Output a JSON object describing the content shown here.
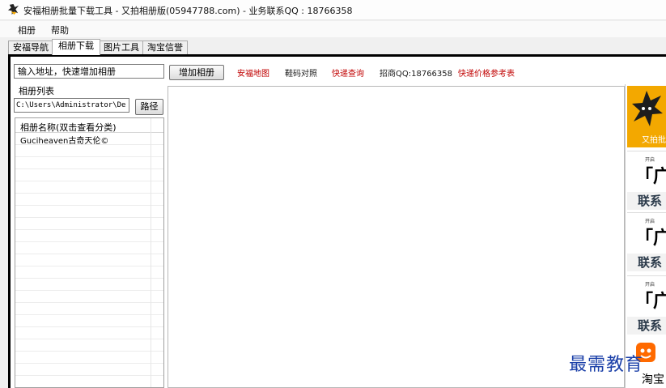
{
  "window": {
    "title": "安福相册批量下载工具 - 又拍相册版(05947788.com) - 业务联系QQ : 18766358"
  },
  "menu": [
    "相册",
    "帮助"
  ],
  "tabs": [
    "安福导航",
    "相册下载",
    "图片工具",
    "淘宝信誉"
  ],
  "active_tab_index": 1,
  "toolbar": {
    "url_placeholder": "输入地址，快速增加相册",
    "add_button": "增加相册",
    "links": [
      "安福地图",
      "鞋码对照",
      "快递查询",
      "招商QQ:18766358",
      "快递价格参考表"
    ]
  },
  "album_section": {
    "label": "相册列表",
    "path_value": "C:\\Users\\Administrator\\De",
    "path_button": "路径",
    "column_header": "相册名称(双击查看分类)",
    "rows": [
      "Guciheaven古奇天伦©"
    ]
  },
  "sidebar": {
    "logo_caption": "又拍批",
    "ads": [
      {
        "small": "开启",
        "big": "「广",
        "contact": "联系"
      },
      {
        "small": "开启",
        "big": "「广",
        "contact": "联系"
      },
      {
        "small": "开启",
        "big": "「广",
        "contact": "联系"
      }
    ],
    "bottom_label": "淘宝"
  },
  "watermark": "最需教育",
  "colors": {
    "link_red": "#c00000",
    "logo_orange": "#f3a800",
    "watermark_blue": "#1a3fa8"
  }
}
